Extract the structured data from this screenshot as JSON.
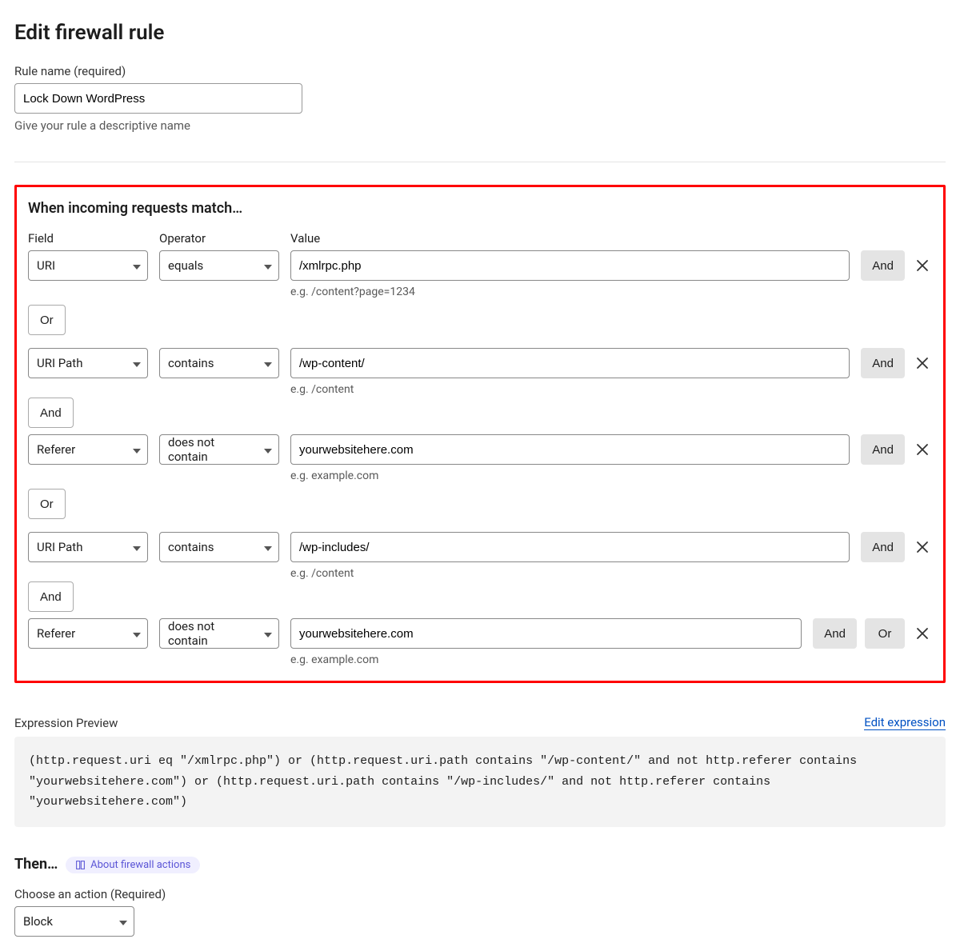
{
  "page": {
    "title": "Edit firewall rule",
    "rule_name_label": "Rule name (required)",
    "rule_name_value": "Lock Down WordPress",
    "rule_name_help": "Give your rule a descriptive name"
  },
  "match": {
    "heading": "When incoming requests match…",
    "col_field": "Field",
    "col_operator": "Operator",
    "col_value": "Value"
  },
  "labels": {
    "and": "And",
    "or": "Or"
  },
  "rows": [
    {
      "field": "URI",
      "operator": "equals",
      "value": "/xmlrpc.php",
      "hint": "e.g. /content?page=1234"
    },
    {
      "field": "URI Path",
      "operator": "contains",
      "value": "/wp-content/",
      "hint": "e.g. /content"
    },
    {
      "field": "Referer",
      "operator": "does not contain",
      "value": "yourwebsitehere.com",
      "hint": "e.g. example.com"
    },
    {
      "field": "URI Path",
      "operator": "contains",
      "value": "/wp-includes/",
      "hint": "e.g. /content"
    },
    {
      "field": "Referer",
      "operator": "does not contain",
      "value": "yourwebsitehere.com",
      "hint": "e.g. example.com"
    }
  ],
  "expression": {
    "title": "Expression Preview",
    "edit_link": "Edit expression",
    "text": "(http.request.uri eq \"/xmlrpc.php\") or (http.request.uri.path contains \"/wp-content/\" and not http.referer contains \"yourwebsitehere.com\") or (http.request.uri.path contains \"/wp-includes/\" and not http.referer contains \"yourwebsitehere.com\")"
  },
  "action": {
    "heading": "Then…",
    "about_link": "About firewall actions",
    "choose_label": "Choose an action (Required)",
    "value": "Block"
  }
}
